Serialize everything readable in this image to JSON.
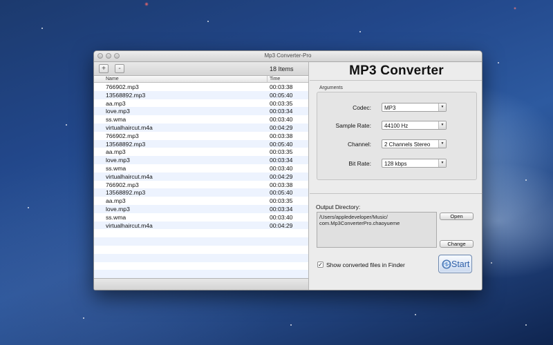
{
  "window": {
    "title": "Mp3 Converter-Pro"
  },
  "left": {
    "add_label": "+",
    "remove_label": "-",
    "items_count": "18 Items",
    "columns": {
      "name": "Name",
      "time": "Time"
    },
    "files": [
      {
        "name": "766902.mp3",
        "time": "00:03:38"
      },
      {
        "name": "13568892.mp3",
        "time": "00:05:40"
      },
      {
        "name": "aa.mp3",
        "time": "00:03:35"
      },
      {
        "name": "love.mp3",
        "time": "00:03:34"
      },
      {
        "name": "ss.wma",
        "time": "00:03:40"
      },
      {
        "name": "virtualhaircut.m4a",
        "time": "00:04:29"
      },
      {
        "name": "766902.mp3",
        "time": "00:03:38"
      },
      {
        "name": "13568892.mp3",
        "time": "00:05:40"
      },
      {
        "name": "aa.mp3",
        "time": "00:03:35"
      },
      {
        "name": "love.mp3",
        "time": "00:03:34"
      },
      {
        "name": "ss.wma",
        "time": "00:03:40"
      },
      {
        "name": "virtualhaircut.m4a",
        "time": "00:04:29"
      },
      {
        "name": "766902.mp3",
        "time": "00:03:38"
      },
      {
        "name": "13568892.mp3",
        "time": "00:05:40"
      },
      {
        "name": "aa.mp3",
        "time": "00:03:35"
      },
      {
        "name": "love.mp3",
        "time": "00:03:34"
      },
      {
        "name": "ss.wma",
        "time": "00:03:40"
      },
      {
        "name": "virtualhaircut.m4a",
        "time": "00:04:29"
      }
    ]
  },
  "right": {
    "app_title": "MP3 Converter",
    "arguments_label": "Arguments",
    "codec": {
      "label": "Codec:",
      "value": "MP3"
    },
    "sample_rate": {
      "label": "Sample Rate:",
      "value": "44100 Hz"
    },
    "channel": {
      "label": "Channel:",
      "value": "2 Channels Stereo"
    },
    "bit_rate": {
      "label": "Bit Rate:",
      "value": "128 kbps"
    },
    "output_directory_label": "Output Directory:",
    "output_path_line1": "/Users/appledeveloper/Music/",
    "output_path_line2": "com.Mp3ConverterPro.chaoyueme",
    "open_label": "Open",
    "change_label": "Change",
    "show_in_finder_label": "Show converted files in Finder",
    "show_in_finder_checked": true,
    "start_label": "Start"
  },
  "colors": {
    "row_alt": "#edf3fe",
    "start_text": "#2d5ea8"
  }
}
